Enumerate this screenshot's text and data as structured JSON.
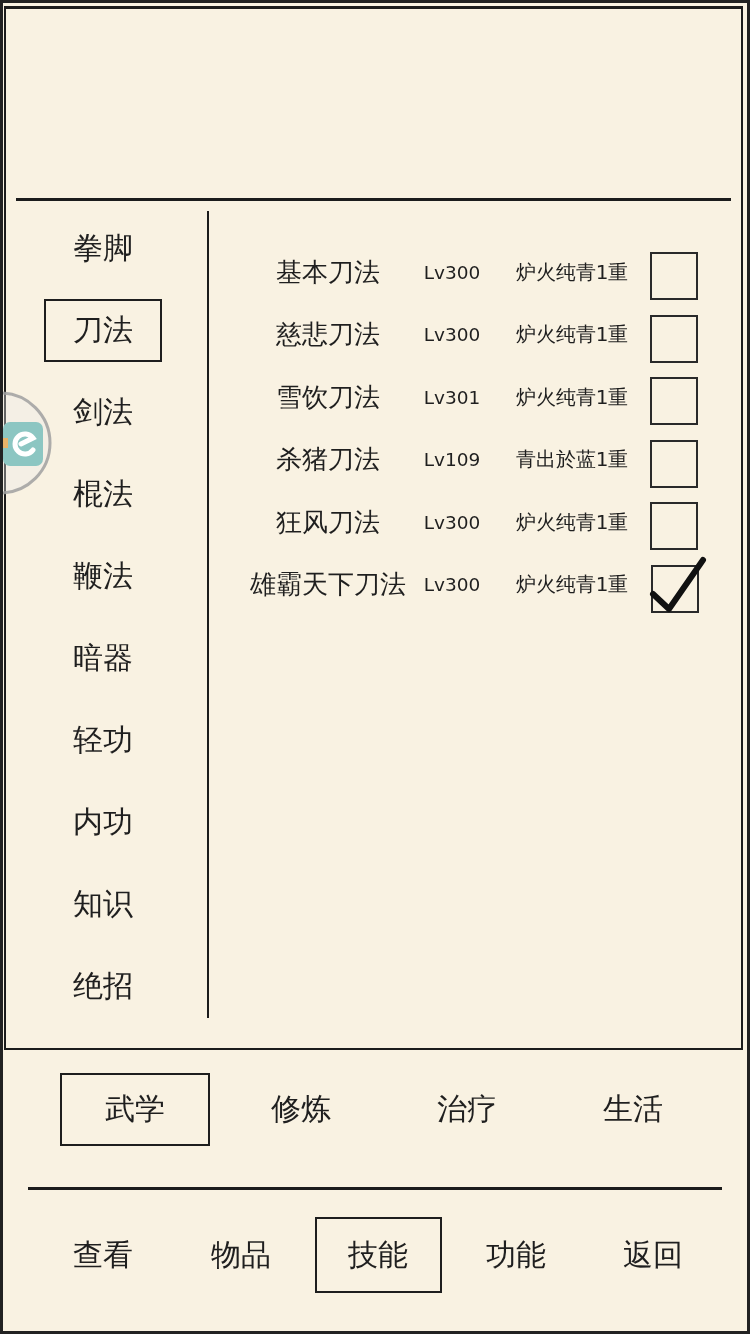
{
  "categories": [
    {
      "label": "拳脚",
      "selected": false
    },
    {
      "label": "刀法",
      "selected": true
    },
    {
      "label": "剑法",
      "selected": false
    },
    {
      "label": "棍法",
      "selected": false
    },
    {
      "label": "鞭法",
      "selected": false
    },
    {
      "label": "暗器",
      "selected": false
    },
    {
      "label": "轻功",
      "selected": false
    },
    {
      "label": "内功",
      "selected": false
    },
    {
      "label": "知识",
      "selected": false
    },
    {
      "label": "绝招",
      "selected": false
    }
  ],
  "skills": [
    {
      "name": "基本刀法",
      "grade": "Lv300",
      "realm": "炉火纯青1重",
      "checked": false
    },
    {
      "name": "慈悲刀法",
      "grade": "Lv300",
      "realm": "炉火纯青1重",
      "checked": false
    },
    {
      "name": "雪饮刀法",
      "grade": "Lv301",
      "realm": "炉火纯青1重",
      "checked": false
    },
    {
      "name": "杀猪刀法",
      "grade": "Lv109",
      "realm": "青出於蓝1重",
      "checked": false
    },
    {
      "name": "狂风刀法",
      "grade": "Lv300",
      "realm": "炉火纯青1重",
      "checked": false
    },
    {
      "name": "雄霸天下刀法",
      "grade": "Lv300",
      "realm": "炉火纯青1重",
      "checked": true
    }
  ],
  "sub_tabs": [
    {
      "label": "武学",
      "selected": true
    },
    {
      "label": "修炼",
      "selected": false
    },
    {
      "label": "治疗",
      "selected": false
    },
    {
      "label": "生活",
      "selected": false
    }
  ],
  "nav": [
    {
      "label": "查看",
      "selected": false
    },
    {
      "label": "物品",
      "selected": false
    },
    {
      "label": "技能",
      "selected": true
    },
    {
      "label": "功能",
      "selected": false
    },
    {
      "label": "返回",
      "selected": false
    }
  ]
}
